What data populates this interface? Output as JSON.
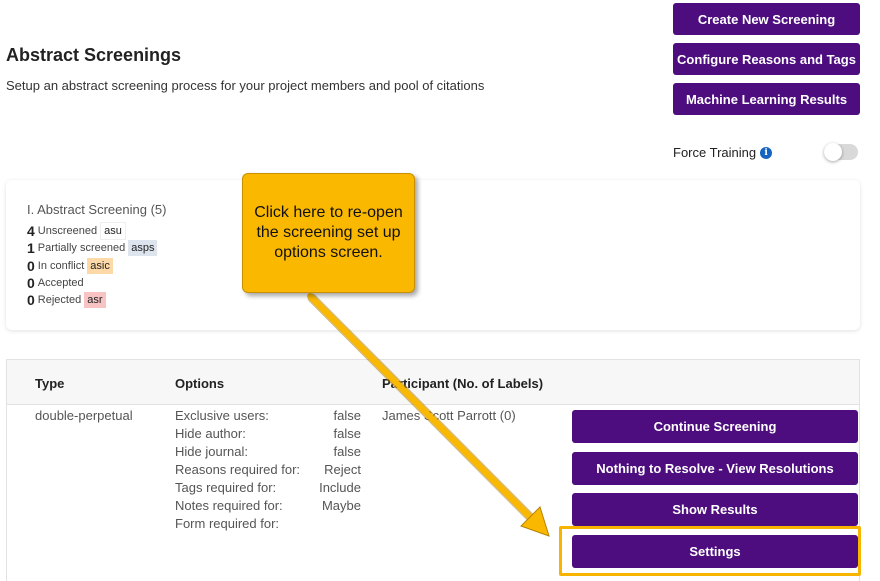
{
  "header": {
    "title": "Abstract Screenings",
    "description": "Setup an abstract screening process for your project members and pool of citations"
  },
  "actions": {
    "create_new": "Create New Screening",
    "configure_reasons": "Configure Reasons and Tags",
    "ml_results": "Machine Learning Results"
  },
  "force_training": {
    "label": "Force Training",
    "info_icon": "i",
    "enabled": false
  },
  "summary": {
    "title": "I. Abstract Screening (5)",
    "stats": [
      {
        "count": "4",
        "label": "Unscreened",
        "tag": "asu"
      },
      {
        "count": "1",
        "label": "Partially screened",
        "tag": "asps"
      },
      {
        "count": "0",
        "label": "In conflict",
        "tag": "asic"
      },
      {
        "count": "0",
        "label": "Accepted",
        "tag": ""
      },
      {
        "count": "0",
        "label": "Rejected",
        "tag": "asr"
      }
    ]
  },
  "table": {
    "headers": {
      "type": "Type",
      "options": "Options",
      "participant": "Participant (No. of Labels)"
    },
    "row": {
      "type": "double-perpetual",
      "participant": "James Scott Parrott (0)",
      "options": [
        {
          "label": "Exclusive users:",
          "value": "false"
        },
        {
          "label": "Hide author:",
          "value": "false"
        },
        {
          "label": "Hide journal:",
          "value": "false"
        },
        {
          "label": "Reasons required for:",
          "value": "Reject"
        },
        {
          "label": "Tags required for:",
          "value": "Include"
        },
        {
          "label": "Notes required for:",
          "value": "Maybe"
        },
        {
          "label": "Form required for:",
          "value": ""
        }
      ],
      "buttons": {
        "continue": "Continue Screening",
        "resolutions": "Nothing to Resolve - View Resolutions",
        "results": "Show Results",
        "settings": "Settings"
      }
    }
  },
  "callout": {
    "text": "Click here to re-open the screening set up options screen."
  },
  "colors": {
    "primary": "#4d0d7e",
    "callout": "#fbb800",
    "highlight": "#f7b500"
  }
}
